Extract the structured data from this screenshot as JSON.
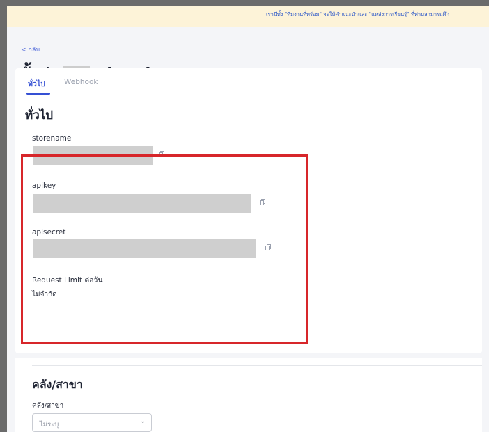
{
  "banner": {
    "text": "เรามีทั้ง \"ทีมงานที่พร้อม\" จะให้คำแนะนำและ \"แหล่งการเรียนรู้\" ที่ท่านสามารถศึก"
  },
  "header": {
    "back_label": "< กลับ",
    "title_prefix": "ตั้งค่า",
    "title_suffix": "- local"
  },
  "tabs": [
    {
      "label": "ทั่วไป",
      "active": true
    },
    {
      "label": "Webhook",
      "active": false
    }
  ],
  "general": {
    "section_title": "ทั่วไป",
    "fields": [
      {
        "label": "storename",
        "value": ""
      },
      {
        "label": "apikey",
        "value": ""
      },
      {
        "label": "apisecret",
        "value": ""
      }
    ],
    "request_limit": {
      "label": "Request Limit ต่อวัน",
      "value": "ไม่จำกัด"
    }
  },
  "branch": {
    "section_title": "คลัง/สาขา",
    "field_label": "คลัง/สาขา",
    "select_value": "ไม่ระบุ"
  },
  "colors": {
    "accent": "#3550d4",
    "highlight": "#d7262a",
    "banner_bg": "#fdf3d8",
    "redaction": "#cfcfcf"
  },
  "icons": {
    "copy": "copy-icon",
    "back": "chevron-left-icon",
    "select": "chevron-down-icon"
  }
}
